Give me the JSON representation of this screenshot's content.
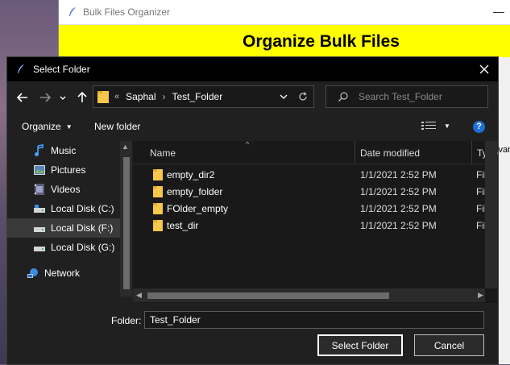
{
  "background_app": {
    "title": "Bulk Files Organizer",
    "banner": "Organize Bulk Files",
    "banner_color": "#ffff00",
    "partial_label": "ivar"
  },
  "dialog": {
    "title": "Select Folder",
    "breadcrumb": {
      "overflow": "«",
      "items": [
        "Saphal",
        "Test_Folder"
      ],
      "separator": "›"
    },
    "search_placeholder": "Search Test_Folder",
    "toolbar": {
      "organize": "Organize",
      "new_folder": "New folder",
      "help": "?"
    },
    "nav_items": [
      {
        "label": "Music",
        "icon": "music-icon"
      },
      {
        "label": "Pictures",
        "icon": "pictures-icon"
      },
      {
        "label": "Videos",
        "icon": "videos-icon"
      },
      {
        "label": "Local Disk (C:)",
        "icon": "disk-icon"
      },
      {
        "label": "Local Disk (F:)",
        "icon": "disk-icon",
        "selected": true
      },
      {
        "label": "Local Disk (G:)",
        "icon": "disk-icon"
      },
      {
        "label": "Network",
        "icon": "network-icon"
      }
    ],
    "columns": {
      "name": "Name",
      "date": "Date modified",
      "type": "Type"
    },
    "files": [
      {
        "name": "empty_dir2",
        "date": "1/1/2021 2:52 PM",
        "type": "File folder"
      },
      {
        "name": "empty_folder",
        "date": "1/1/2021 2:52 PM",
        "type": "File folder"
      },
      {
        "name": "FOlder_empty",
        "date": "1/1/2021 2:52 PM",
        "type": "File folder"
      },
      {
        "name": "test_dir",
        "date": "1/1/2021 2:52 PM",
        "type": "File folder"
      }
    ],
    "folder_label": "Folder:",
    "folder_value": "Test_Folder",
    "select_button": "Select Folder",
    "cancel_button": "Cancel"
  }
}
